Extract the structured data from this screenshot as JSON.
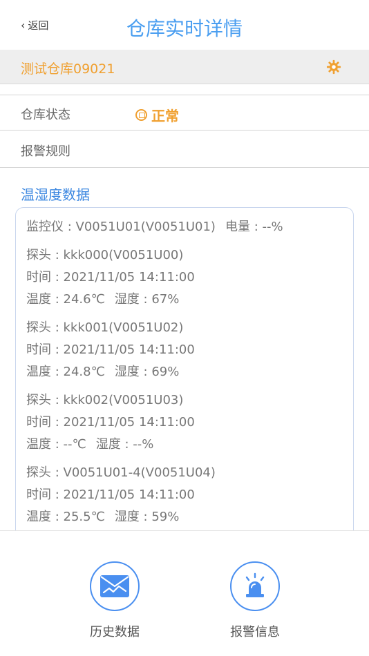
{
  "header": {
    "back_label": "返回",
    "back_icon": "chevron-left-icon",
    "title": "仓库实时详情"
  },
  "warehouse": {
    "name": "测试仓库09021",
    "settings_icon": "gear-icon"
  },
  "status_row": {
    "label": "仓库状态",
    "value": "正常",
    "icon": "status-normal-icon"
  },
  "alarm_rule": {
    "label": "报警规则"
  },
  "sensor_section": {
    "title": "温湿度数据",
    "monitor": {
      "text": "监控仪 : V0051U01(V0051U01)",
      "battery": "电量 : --%"
    },
    "probes": [
      {
        "name": "探头 : kkk000(V0051U00)",
        "time": "时间 : 2021/11/05 14:11:00",
        "temp": "温度 : 24.6℃",
        "humidity": "湿度 : 67%"
      },
      {
        "name": "探头 : kkk001(V0051U02)",
        "time": "时间 : 2021/11/05 14:11:00",
        "temp": "温度 : 24.8℃",
        "humidity": "湿度 : 69%"
      },
      {
        "name": "探头 : kkk002(V0051U03)",
        "time": "时间 : 2021/11/05 14:11:00",
        "temp": "温度 : --℃",
        "humidity": "湿度 : --%"
      },
      {
        "name": "探头 : V0051U01-4(V0051U04)",
        "time": "时间 : 2021/11/05 14:11:00",
        "temp": "温度 : 25.5℃",
        "humidity": "湿度 : 59%"
      }
    ]
  },
  "footer": {
    "history": {
      "label": "历史数据",
      "icon": "history-envelope-icon"
    },
    "alarm": {
      "label": "报警信息",
      "icon": "alarm-siren-icon"
    }
  },
  "colors": {
    "accent_blue": "#4a9ef0",
    "warning_orange": "#f0a030",
    "card_border": "#c9d6ee"
  }
}
